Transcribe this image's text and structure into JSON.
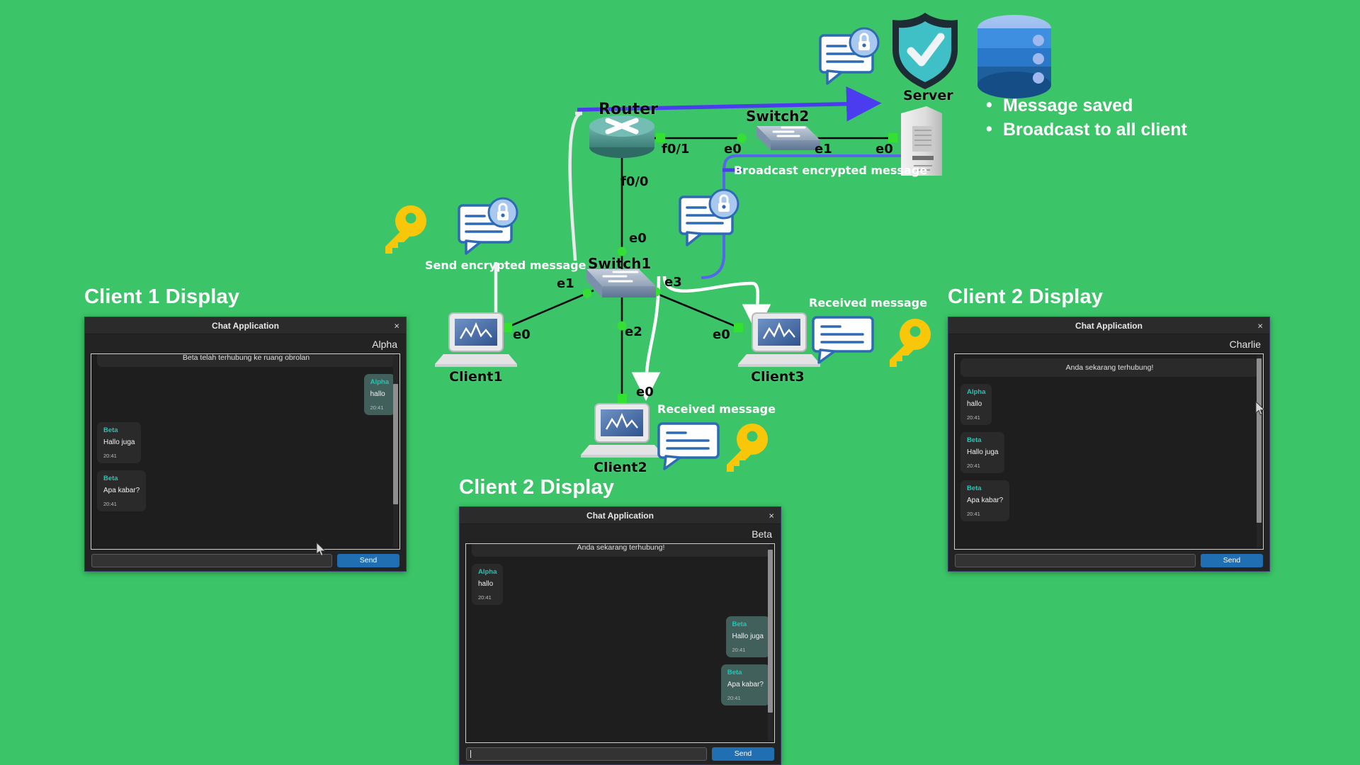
{
  "background_color": "#3bc568",
  "slide_labels": {
    "client1": "Client 1 Display",
    "client2_center": "Client 2 Display",
    "client2_right": "Client 2 Display"
  },
  "windows": {
    "client1": {
      "title": "Chat Application",
      "close_label": "×",
      "username": "Alpha",
      "system_message": "Beta telah terhubung ke ruang obrolan",
      "messages": [
        {
          "who": "Alpha",
          "text": "hallo",
          "time": "20:41",
          "side": "right"
        },
        {
          "who": "Beta",
          "text": "Hallo juga",
          "time": "20:41",
          "side": "left"
        },
        {
          "who": "Beta",
          "text": "Apa kabar?",
          "time": "20:41",
          "side": "left"
        }
      ],
      "input_value": "",
      "input_placeholder": "",
      "send_label": "Send"
    },
    "client2_center": {
      "title": "Chat Application",
      "close_label": "×",
      "username": "Beta",
      "system_message": "Anda sekarang terhubung!",
      "messages": [
        {
          "who": "Alpha",
          "text": "hallo",
          "time": "20:41",
          "side": "left"
        },
        {
          "who": "Beta",
          "text": "Hallo juga",
          "time": "20:41",
          "side": "right"
        },
        {
          "who": "Beta",
          "text": "Apa kabar?",
          "time": "20:41",
          "side": "right"
        }
      ],
      "input_value": "",
      "input_placeholder": "",
      "send_label": "Send"
    },
    "client2_right": {
      "title": "Chat Application",
      "close_label": "×",
      "username": "Charlie",
      "system_message": "Anda sekarang terhubung!",
      "messages": [
        {
          "who": "Alpha",
          "text": "hallo",
          "time": "20:41",
          "side": "left"
        },
        {
          "who": "Beta",
          "text": "Hallo juga",
          "time": "20:41",
          "side": "left"
        },
        {
          "who": "Beta",
          "text": "Apa kabar?",
          "time": "20:41",
          "side": "left"
        }
      ],
      "input_value": "",
      "input_placeholder": "",
      "send_label": "Send"
    }
  },
  "diagram": {
    "nodes": {
      "router": "Router",
      "switch1": "Switch1",
      "switch2": "Switch2",
      "server": "Server",
      "client1": "Client1",
      "client2": "Client2",
      "client3": "Client3"
    },
    "ports": {
      "router_f01": "f0/1",
      "router_f00": "f0/0",
      "switch2_e0": "e0",
      "switch2_e1": "e1",
      "server_e0": "e0",
      "switch1_e0": "e0",
      "switch1_e1": "e1",
      "switch1_e2": "e2",
      "switch1_e3": "e3",
      "client1_e0": "e0",
      "client2_e0": "e0",
      "client3_e0": "e0"
    },
    "flow_labels": {
      "send_encrypted": "Send encrypted message",
      "broadcast_encrypted": "Broadcast encrypted message",
      "received_client3": "Received message",
      "received_client2": "Received message"
    },
    "bullets": [
      "Message saved",
      "Broadcast to all client"
    ],
    "colors": {
      "link_black": "#0a0a0a",
      "port_marker": "#33e033",
      "arrow_purple": "#4b3cf0",
      "path_white": "#e9e9ee",
      "path_blue": "#5566e8",
      "key_yellow": "#f9c70a",
      "bubble_blue": "#2f6bb5",
      "shield_teal": "#3fc0c7"
    }
  }
}
